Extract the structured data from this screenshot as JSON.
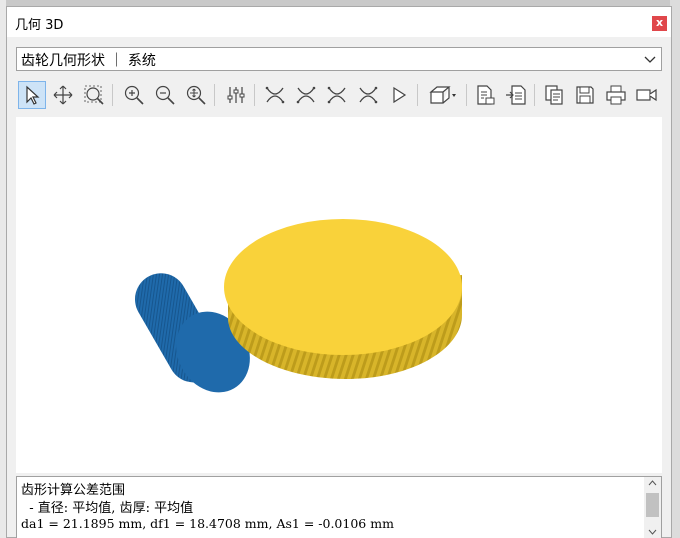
{
  "window": {
    "title": "几何 3D",
    "close_label": "x"
  },
  "selector": {
    "value": "齿轮几何形状 ｜ 系统"
  },
  "toolbar": {
    "tools": [
      "select-arrow-icon",
      "pan-move-icon",
      "zoom-window-icon",
      "zoom-in-icon",
      "zoom-out-icon",
      "zoom-fit-icon",
      "settings-sliders-icon",
      "view-curve-1-icon",
      "view-curve-2-icon",
      "view-curve-3-icon",
      "view-curve-4-icon",
      "play-icon",
      "cube-view-icon",
      "export-document-icon",
      "import-document-icon",
      "copy-icon",
      "save-icon",
      "print-icon",
      "video-camera-icon"
    ]
  },
  "scene": {
    "colors": {
      "pinion": "#1f6aab",
      "wheel": "#f9d23a",
      "wheel_teeth": "#d8b52a"
    }
  },
  "output": {
    "line1": "齿形计算公差范围",
    "line2": "  - 直径: 平均值, 齿厚: 平均值",
    "line3": "da1 = 21.1895 mm, df1 = 18.4708 mm, As1 = -0.0106 mm"
  }
}
